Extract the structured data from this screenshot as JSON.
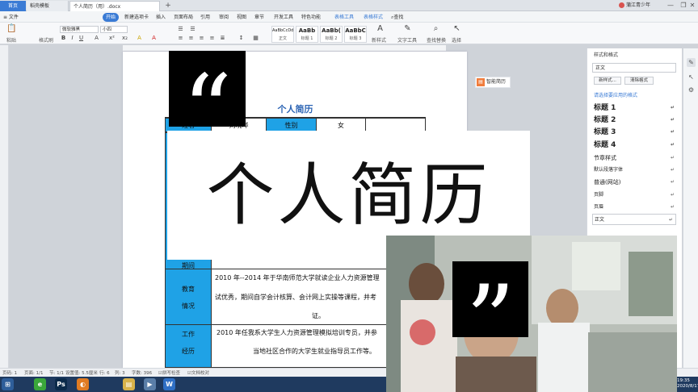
{
  "titlebar": {
    "home_tab": "首页",
    "templates_tab": "稻壳模板",
    "doc_tab": "个人简历（用）.docx",
    "add_tab": "+",
    "user_name": "蒲江青少年",
    "min": "—",
    "max": "❐",
    "close": "✕"
  },
  "menubar": {
    "file": "≡ 文件",
    "items": [
      "开始",
      "插入",
      "页面布局",
      "引用",
      "审阅",
      "视图",
      "章节",
      "开发工具",
      "特色功能",
      "表格工具",
      "表格样式",
      "查找"
    ],
    "active_label": "开始",
    "new_tab_label": "新建选项卡"
  },
  "ribbon": {
    "paste_label": "粘贴",
    "format_painter_label": "格式刷",
    "font_name": "微软雅黑",
    "font_size": "小四",
    "styles": [
      {
        "preview": "AaBbCcDd",
        "label": "正文"
      },
      {
        "preview": "AaBb",
        "label": "标题 1"
      },
      {
        "preview": "AaBb(",
        "label": "标题 2"
      },
      {
        "preview": "AaBbC",
        "label": "标题 3"
      }
    ],
    "new_style_label": "新样式",
    "text_tools_label": "文字工具",
    "find_replace_label": "查找替换",
    "select_label": "选择"
  },
  "document": {
    "resume_title": "个人简历",
    "name_label": "姓名",
    "name_value": "刘晓晔",
    "gender_label": "性别",
    "gender_value": "女",
    "section_label_partial": "期间",
    "edu_label_1": "教育",
    "edu_label_2": "情况",
    "edu_line_1": "2010 年--2014 年于华南师范大学就读企业人力资源管理",
    "edu_line_2": "试优秀，期间自学会计核算、会计网上实操等课程，并考",
    "edu_line_3": "证。",
    "work_label_1": "工作",
    "work_label_2": "经历",
    "work_line_1": "2010 年任我系大学生人力资源管理模拟培训专员，并参",
    "work_line_2": "当地社区合作的大学生就业指导员工作等。"
  },
  "smart_resume": "智能简历",
  "style_panel": {
    "header": "样式和格式",
    "current_style": "正文",
    "new_style_button": "新样式...",
    "clear_format_button": "清除格式",
    "hint": "请选择要应用的格式",
    "styles": [
      "标题 1",
      "标题 2",
      "标题 3",
      "标题 4",
      "节章样式",
      "默认段落字体",
      "普通(网站)",
      "页脚",
      "页眉",
      "正文"
    ],
    "return_mark": "↵"
  },
  "statusbar": {
    "page": "页码: 1",
    "pages": "页面: 1/1",
    "section": "节: 1/1",
    "setting": "设置值: 5.5厘米",
    "row": "行: 6",
    "col": "列: 3",
    "words": "字数: 396",
    "spell_check": "拼写检查",
    "doc_check": "文档校对"
  },
  "overlay": {
    "open_quote": "“",
    "close_quote": "”",
    "title_card_text": "个人简历",
    "timestamp": "19:35\n2020/8/17"
  },
  "taskbar": {
    "icons": [
      "start-orb",
      "browser",
      "photoshop",
      "fox",
      "explorer",
      "media",
      "wps-writer"
    ],
    "glyphs": [
      "⊞",
      "e",
      "Ps",
      "◐",
      "▤",
      "▶",
      "W"
    ],
    "colors": [
      "#2e5e9a",
      "#3aa63a",
      "#0b2a4a",
      "#e07b22",
      "#d8b24a",
      "#5a7ea8",
      "#2f6fc4"
    ]
  },
  "colors": {
    "accent": "#3a7bd5",
    "resume_label_bg": "#1fa2e6",
    "resume_title": "#2c64b4"
  }
}
